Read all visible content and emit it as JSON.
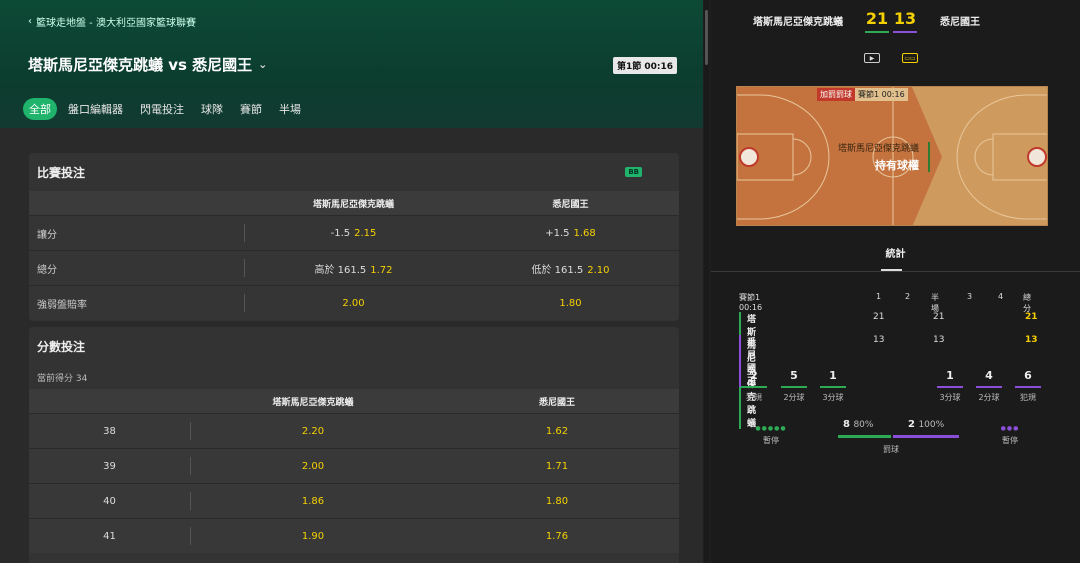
{
  "left": {
    "breadcrumb": "籃球走地盤 - 澳大利亞國家籃球聯賽",
    "match_title": "塔斯馬尼亞傑克跳蟻 vs 悉尼國王",
    "live_badge": "第1節 00:16",
    "tabs": [
      "全部",
      "盤口編輯器",
      "閃電投注",
      "球隊",
      "賽節",
      "半場"
    ],
    "card1": {
      "title": "比賽投注",
      "badge": "BB",
      "col_home": "塔斯馬尼亞傑克跳蟻",
      "col_away": "悉尼國王",
      "rows": [
        {
          "label": "讓分",
          "home_line": "-1.5",
          "home_odds": "2.15",
          "away_line": "+1.5",
          "away_odds": "1.68"
        },
        {
          "label": "總分",
          "home_line": "高於 161.5",
          "home_odds": "1.72",
          "away_line": "低於 161.5",
          "away_odds": "2.10"
        },
        {
          "label": "強弱盤賠率",
          "home_line": "",
          "home_odds": "2.00",
          "away_line": "",
          "away_odds": "1.80"
        }
      ]
    },
    "card2": {
      "title": "分數投注",
      "current_score": "當前得分 34",
      "col_home": "塔斯馬尼亞傑克跳蟻",
      "col_away": "悉尼國王",
      "rows": [
        {
          "points": "38",
          "home": "2.20",
          "away": "1.62"
        },
        {
          "points": "39",
          "home": "2.00",
          "away": "1.71"
        },
        {
          "points": "40",
          "home": "1.86",
          "away": "1.80"
        },
        {
          "points": "41",
          "home": "1.90",
          "away": "1.76"
        }
      ]
    }
  },
  "right": {
    "home_team": "塔斯馬尼亞傑克跳蟻",
    "away_team": "悉尼國王",
    "home_score": "21",
    "away_score": "13",
    "media": {
      "video_icon": "play-video-icon",
      "court_icon": "court-view-icon"
    },
    "court": {
      "tag_a": "加罰罰球",
      "tag_b": "賽節1  00:16",
      "team": "塔斯馬尼亞傑克跳蟻",
      "possession": "持有球權"
    },
    "stats_tab": "統計",
    "quarter_table": {
      "period": "賽節1  00:16",
      "headers": [
        "1",
        "2",
        "半場",
        "3",
        "4",
        "總分"
      ],
      "home": {
        "name": "塔斯馬尼亞傑克跳蟻",
        "q1": "21",
        "half": "21",
        "total": "21"
      },
      "away": {
        "name": "悉尼國王",
        "q1": "13",
        "half": "13",
        "total": "13"
      }
    },
    "home_stats": [
      {
        "value": "2",
        "label": "犯規"
      },
      {
        "value": "5",
        "label": "2分球"
      },
      {
        "value": "1",
        "label": "3分球"
      }
    ],
    "away_stats": [
      {
        "value": "1",
        "label": "3分球"
      },
      {
        "value": "4",
        "label": "2分球"
      },
      {
        "value": "6",
        "label": "犯規"
      }
    ],
    "timeouts": {
      "home_label": "暫停",
      "away_label": "暫停",
      "home_dots": "●●●●●",
      "away_dots": "●●●"
    },
    "free_throws": {
      "home_value": "8",
      "home_pct": "80%",
      "away_value": "2",
      "away_pct": "100%",
      "label": "罰球",
      "home_fraction": 0.8,
      "away_fraction": 1.0
    },
    "colors": {
      "home": "#2eaa55",
      "away": "#8a4fd6",
      "odds": "#f5d000",
      "accent": "#1fb36c"
    }
  }
}
